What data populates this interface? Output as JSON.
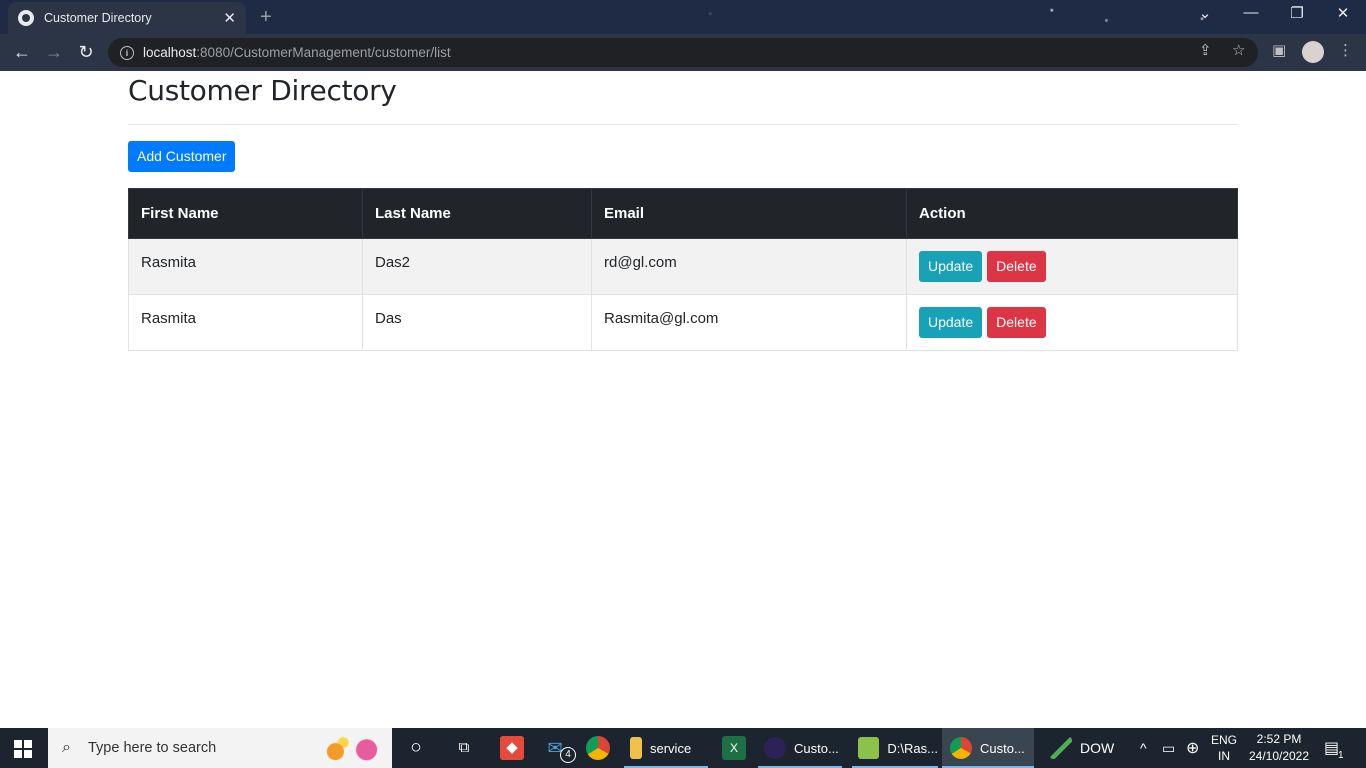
{
  "browser": {
    "tab_title": "Customer Directory",
    "tab_close": "✕",
    "new_tab": "+",
    "url_host": "localhost",
    "url_path": ":8080/CustomerManagement/customer/list",
    "window_controls": {
      "dropdown": "⌄",
      "minimize": "—",
      "restore": "❐",
      "close": "✕"
    },
    "nav": {
      "back": "←",
      "forward": "→",
      "reload": "↻"
    }
  },
  "page": {
    "title": "Customer Directory",
    "add_button": "Add Customer",
    "columns": [
      "First Name",
      "Last Name",
      "Email",
      "Action"
    ],
    "rows": [
      {
        "first_name": "Rasmita",
        "last_name": "Das2",
        "email": "rd@gl.com",
        "update": "Update",
        "delete": "Delete"
      },
      {
        "first_name": "Rasmita",
        "last_name": "Das",
        "email": "Rasmita@gl.com",
        "update": "Update",
        "delete": "Delete"
      }
    ],
    "colors": {
      "primary": "#007bff",
      "info": "#17a2b8",
      "danger": "#dc3545",
      "table_header": "#212529"
    }
  },
  "taskbar": {
    "search_placeholder": "Type here to search",
    "apps": [
      {
        "label": "service"
      },
      {
        "label": "Custo..."
      },
      {
        "label": "D:\\Ras..."
      },
      {
        "label": "Custo..."
      },
      {
        "label": "DOW"
      }
    ],
    "mail_badge": "4",
    "language": "ENG",
    "region": "IN",
    "time": "2:52 PM",
    "date": "24/10/2022",
    "notification_count": "1"
  }
}
